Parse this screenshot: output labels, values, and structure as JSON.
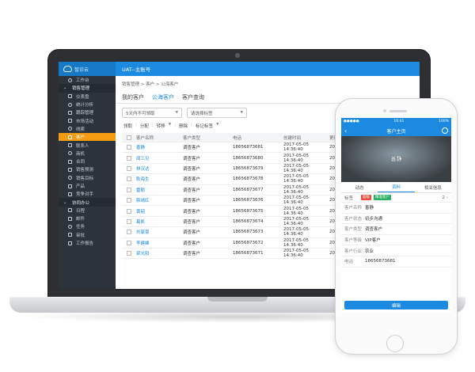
{
  "colors": {
    "brand": "#1b8ae0",
    "sidebar": "#2b333d",
    "active": "#f39c12",
    "tag_red": "#e74c3c",
    "tag_green": "#27ae60"
  },
  "desktop": {
    "logo_text": "智诊云",
    "account": "UAT--主账号",
    "sidebar": [
      {
        "label": "工作台",
        "icon": "desk-icon",
        "group": false
      },
      {
        "label": "销售管理",
        "icon": "chevron-icon",
        "group": true
      },
      {
        "label": "仪表盘",
        "icon": "dashboard-icon",
        "group": false
      },
      {
        "label": "统计分析",
        "icon": "analytics-icon",
        "group": false
      },
      {
        "label": "跟踪管理",
        "icon": "track-icon",
        "group": false
      },
      {
        "label": "市场活动",
        "icon": "campaign-icon",
        "group": false
      },
      {
        "label": "线索",
        "icon": "lead-icon",
        "group": false
      },
      {
        "label": "客户",
        "icon": "customer-icon",
        "group": false,
        "active": true
      },
      {
        "label": "联系人",
        "icon": "contact-icon",
        "group": false
      },
      {
        "label": "商机",
        "icon": "opportunity-icon",
        "group": false
      },
      {
        "label": "合同",
        "icon": "contract-icon",
        "group": false
      },
      {
        "label": "销售预测",
        "icon": "forecast-icon",
        "group": false
      },
      {
        "label": "销售目标",
        "icon": "target-icon",
        "group": false
      },
      {
        "label": "产品",
        "icon": "product-icon",
        "group": false
      },
      {
        "label": "竞争对手",
        "icon": "competitor-icon",
        "group": false
      },
      {
        "label": "协同办公",
        "icon": "chevron-icon",
        "group": true
      },
      {
        "label": "日程",
        "icon": "calendar-icon",
        "group": false
      },
      {
        "label": "邮件",
        "icon": "mail-icon",
        "group": false
      },
      {
        "label": "任务",
        "icon": "task-icon",
        "group": false
      },
      {
        "label": "审批",
        "icon": "approval-icon",
        "group": false
      },
      {
        "label": "工作报告",
        "icon": "report-icon",
        "group": false
      }
    ],
    "breadcrumb": "销售管理 > 客户 > 公海客户",
    "tabs": [
      "我的客户",
      "公海客户",
      "客户查询"
    ],
    "active_tab": 1,
    "filter1": "5天内不可领取",
    "filter2": "请选择标签",
    "actions": [
      "领取",
      "分配",
      "转移",
      "删除",
      "标记标签"
    ],
    "table": {
      "headers": [
        "客户名称",
        "客户类型",
        "电话",
        "创建时间",
        "更新"
      ],
      "rows": [
        {
          "name": "善静",
          "type": "调查客户",
          "phone": "18656873681",
          "time": "2017-05-05 14:36:40",
          "upd": "2017"
        },
        {
          "name": "闻三见",
          "type": "调查客户",
          "phone": "18656873680",
          "time": "2017-05-05 14:36:40",
          "upd": "2017"
        },
        {
          "name": "林汉达",
          "type": "调查客户",
          "phone": "18656873679",
          "time": "2017-05-05 14:36:40",
          "upd": "2017"
        },
        {
          "name": "耿海生",
          "type": "调查客户",
          "phone": "18656873678",
          "time": "2017-05-05 14:36:40",
          "upd": "2017"
        },
        {
          "name": "雷勒",
          "type": "调查客户",
          "phone": "18656873677",
          "time": "2017-05-05 14:36:40",
          "upd": "2017"
        },
        {
          "name": "韩靖红",
          "type": "调查客户",
          "phone": "18656873676",
          "time": "2017-05-05 14:36:40",
          "upd": "2017"
        },
        {
          "name": "黄韬",
          "type": "调查客户",
          "phone": "18656873675",
          "time": "2017-05-05 14:36:40",
          "upd": "2017"
        },
        {
          "name": "葛凯",
          "type": "调查客户",
          "phone": "18656873674",
          "time": "2017-05-05 14:36:40",
          "upd": "2017"
        },
        {
          "name": "刘家豪",
          "type": "调查客户",
          "phone": "18656873673",
          "time": "2017-05-05 14:36:40",
          "upd": "2017"
        },
        {
          "name": "李建峰",
          "type": "调查客户",
          "phone": "18656873672",
          "time": "2017-05-05 14:36:40",
          "upd": "2017"
        },
        {
          "name": "梁光阳",
          "type": "调查客户",
          "phone": "18656873671",
          "time": "2017-05-05 14:36:40",
          "upd": "2017"
        }
      ]
    }
  },
  "mobile": {
    "status_left": "●●●●●",
    "status_time": "16:41",
    "status_right": "100%",
    "nav_title": "客户主页",
    "back": "‹",
    "hero_name": "善静",
    "tabs": [
      "动态",
      "资料",
      "相关信息"
    ],
    "active_tab": 1,
    "tags_label": "标签",
    "tags": [
      {
        "text": "超级",
        "color": "red"
      },
      {
        "text": "精准客户",
        "color": "green"
      }
    ],
    "tags_count": "2",
    "fields": [
      {
        "label": "客户名称",
        "value": "善静"
      },
      {
        "label": "客户状态",
        "value": "初步沟通"
      },
      {
        "label": "客户类型",
        "value": "调查客户"
      },
      {
        "label": "客户等级",
        "value": "VIP客户"
      },
      {
        "label": "客户行业",
        "value": "农业"
      },
      {
        "label": "电话",
        "value": "18656873681"
      }
    ],
    "edit_button": "编辑"
  }
}
